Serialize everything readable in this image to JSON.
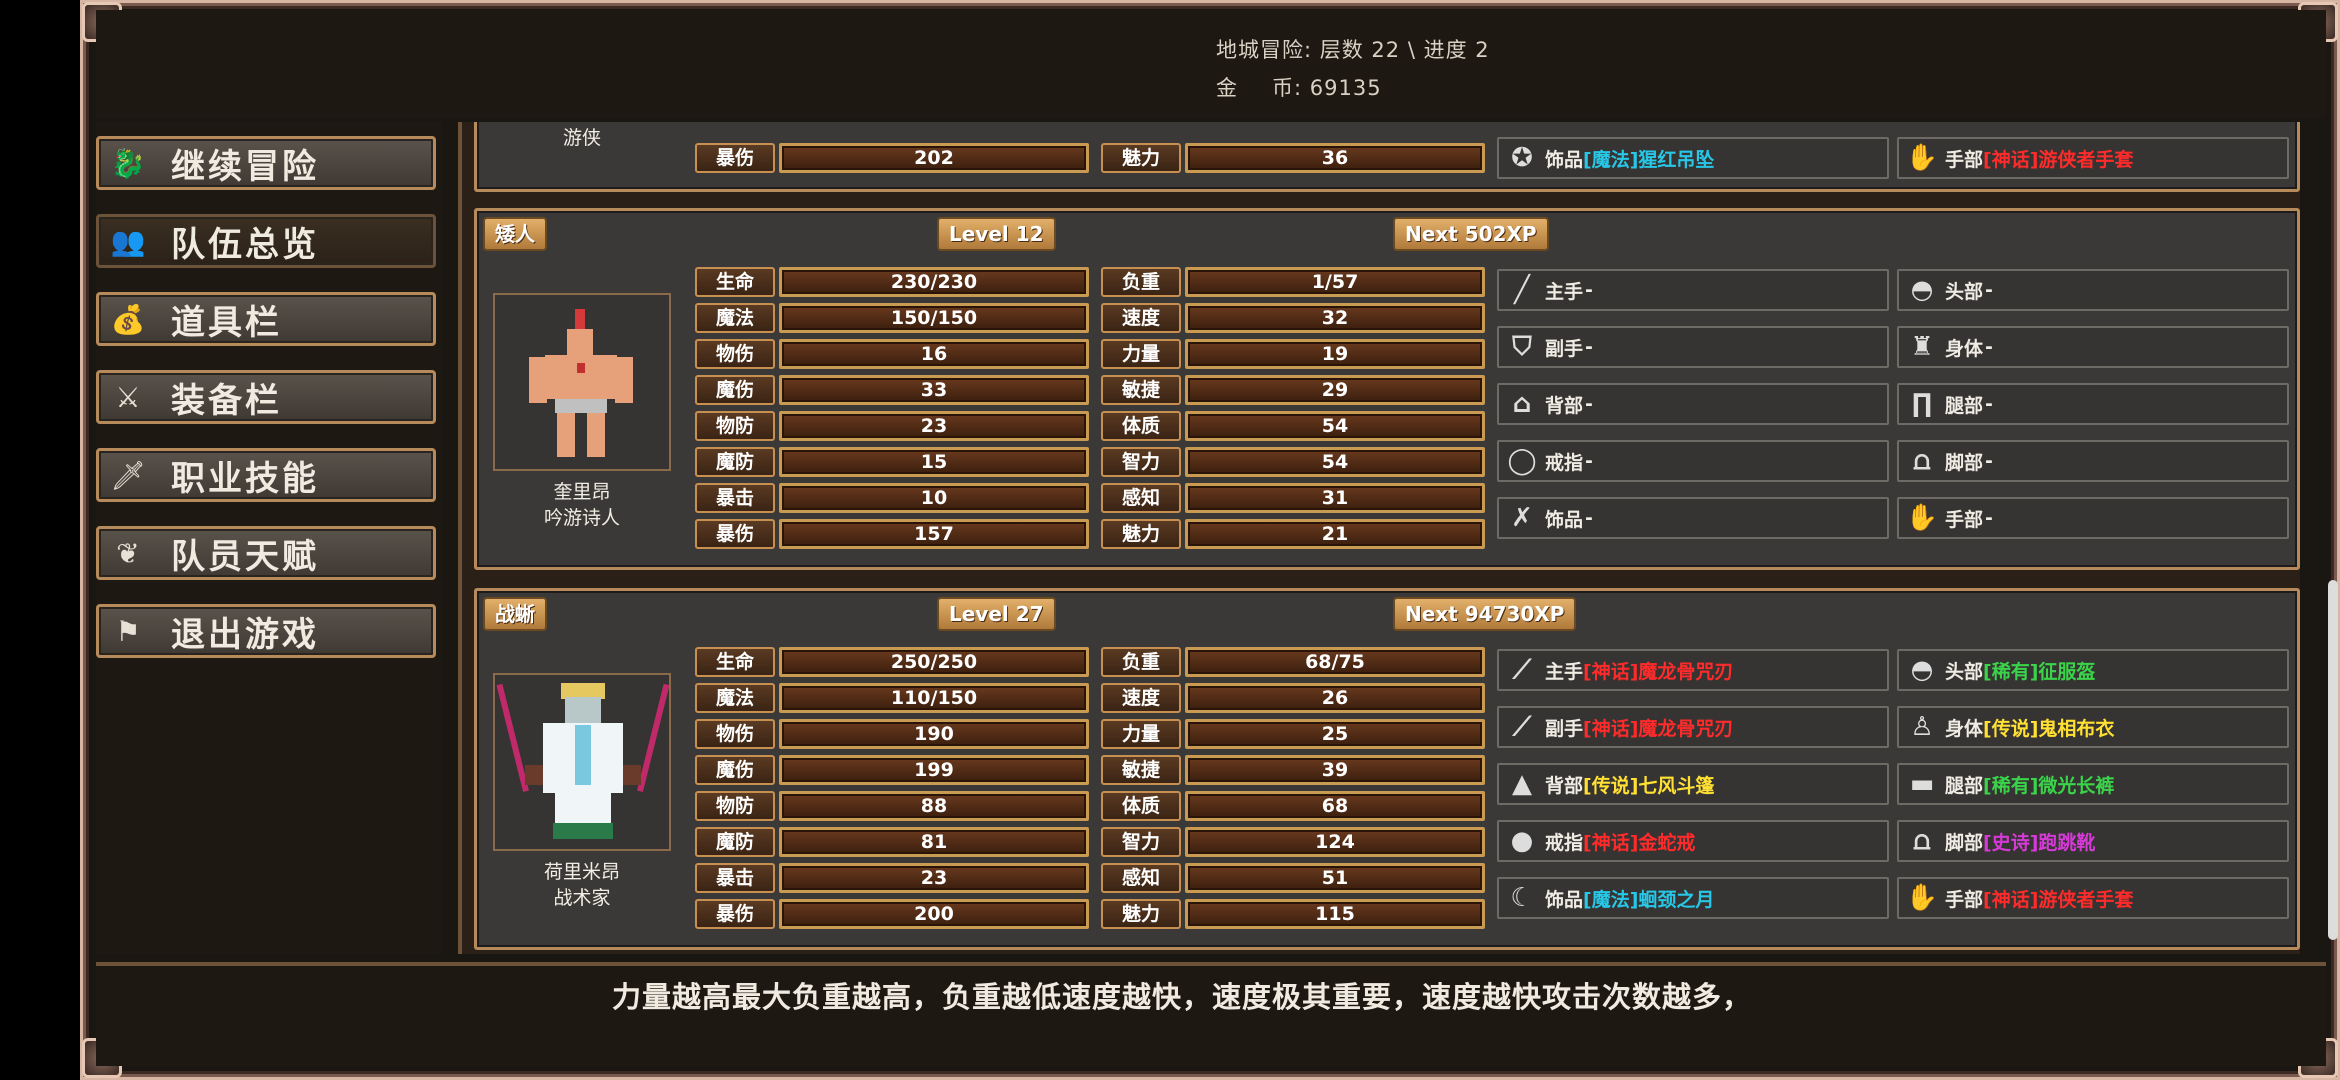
{
  "header": {
    "line1": "地城冒险: 层数 22 \\ 进度 2",
    "gold_label_a": "金",
    "gold_label_b": "币: 69135"
  },
  "sidebar": {
    "items": [
      {
        "label": "继续冒险",
        "icon": "dragon-icon",
        "active": false
      },
      {
        "label": "队伍总览",
        "icon": "party-icon",
        "active": true
      },
      {
        "label": "道具栏",
        "icon": "bag-icon",
        "active": false
      },
      {
        "label": "装备栏",
        "icon": "weapons-icon",
        "active": false
      },
      {
        "label": "职业技能",
        "icon": "sword-wings-icon",
        "active": false
      },
      {
        "label": "队员天赋",
        "icon": "laurel-icon",
        "active": false
      },
      {
        "label": "退出游戏",
        "icon": "flag-icon",
        "active": false
      }
    ]
  },
  "top_partial": {
    "class_label": "游侠",
    "stat_left_label": "暴伤",
    "stat_left_value": "202",
    "stat_right_label": "魅力",
    "stat_right_value": "36",
    "eq_left": {
      "slot": "饰品",
      "quality": "[魔法]",
      "name": "猩红吊坠",
      "q": "mofa"
    },
    "eq_right": {
      "slot": "手部",
      "quality": "[神话]",
      "name": "游侠者手套",
      "q": "shenhua"
    }
  },
  "characters": [
    {
      "race": "矮人",
      "level": "Level 12",
      "next": "Next 502XP",
      "name": "奎里昂",
      "class": "吟游诗人",
      "stats_left": [
        {
          "label": "生命",
          "value": "230/230"
        },
        {
          "label": "魔法",
          "value": "150/150"
        },
        {
          "label": "物伤",
          "value": "16"
        },
        {
          "label": "魔伤",
          "value": "33"
        },
        {
          "label": "物防",
          "value": "23"
        },
        {
          "label": "魔防",
          "value": "15"
        },
        {
          "label": "暴击",
          "value": "10"
        },
        {
          "label": "暴伤",
          "value": "157"
        }
      ],
      "stats_right": [
        {
          "label": "负重",
          "value": "1/57"
        },
        {
          "label": "速度",
          "value": "32"
        },
        {
          "label": "力量",
          "value": "19"
        },
        {
          "label": "敏捷",
          "value": "29"
        },
        {
          "label": "体质",
          "value": "54"
        },
        {
          "label": "智力",
          "value": "54"
        },
        {
          "label": "感知",
          "value": "31"
        },
        {
          "label": "魅力",
          "value": "21"
        }
      ],
      "equip_left": [
        {
          "slot": "主手",
          "dash": "-",
          "icon": "sword-icon"
        },
        {
          "slot": "副手",
          "dash": "-",
          "icon": "shield-icon"
        },
        {
          "slot": "背部",
          "dash": "-",
          "icon": "cape-icon"
        },
        {
          "slot": "戒指",
          "dash": "-",
          "icon": "ring-icon"
        },
        {
          "slot": "饰品",
          "dash": "-",
          "icon": "amulet-icon"
        }
      ],
      "equip_right": [
        {
          "slot": "头部",
          "dash": "-",
          "icon": "helmet-icon"
        },
        {
          "slot": "身体",
          "dash": "-",
          "icon": "armor-icon"
        },
        {
          "slot": "腿部",
          "dash": "-",
          "icon": "legs-icon"
        },
        {
          "slot": "脚部",
          "dash": "-",
          "icon": "boots-icon"
        },
        {
          "slot": "手部",
          "dash": "-",
          "icon": "gloves-icon"
        }
      ]
    },
    {
      "race": "战蜥",
      "level": "Level 27",
      "next": "Next 94730XP",
      "name": "荷里米昂",
      "class": "战术家",
      "stats_left": [
        {
          "label": "生命",
          "value": "250/250"
        },
        {
          "label": "魔法",
          "value": "110/150"
        },
        {
          "label": "物伤",
          "value": "190"
        },
        {
          "label": "魔伤",
          "value": "199"
        },
        {
          "label": "物防",
          "value": "88"
        },
        {
          "label": "魔防",
          "value": "81"
        },
        {
          "label": "暴击",
          "value": "23"
        },
        {
          "label": "暴伤",
          "value": "200"
        }
      ],
      "stats_right": [
        {
          "label": "负重",
          "value": "68/75"
        },
        {
          "label": "速度",
          "value": "26"
        },
        {
          "label": "力量",
          "value": "25"
        },
        {
          "label": "敏捷",
          "value": "39"
        },
        {
          "label": "体质",
          "value": "68"
        },
        {
          "label": "智力",
          "value": "124"
        },
        {
          "label": "感知",
          "value": "51"
        },
        {
          "label": "魅力",
          "value": "115"
        }
      ],
      "equip_left": [
        {
          "slot": "主手",
          "quality": "[神话]",
          "name": "魔龙骨咒刃",
          "q": "shenhua",
          "icon": "purple-blade-icon"
        },
        {
          "slot": "副手",
          "quality": "[神话]",
          "name": "魔龙骨咒刃",
          "q": "shenhua",
          "icon": "purple-blade-icon"
        },
        {
          "slot": "背部",
          "quality": "[传说]",
          "name": "七风斗篷",
          "q": "chuanshuo",
          "icon": "cloak-icon"
        },
        {
          "slot": "戒指",
          "quality": "[神话]",
          "name": "金蛇戒",
          "q": "shenhua",
          "icon": "gold-ring-icon"
        },
        {
          "slot": "饰品",
          "quality": "[魔法]",
          "name": "蛔颈之月",
          "q": "mofa",
          "icon": "moon-amulet-icon"
        }
      ],
      "equip_right": [
        {
          "slot": "头部",
          "quality": "[稀有]",
          "name": "征服盔",
          "q": "xiyou",
          "icon": "bronze-helmet-icon"
        },
        {
          "slot": "身体",
          "quality": "[传说]",
          "name": "鬼相布衣",
          "q": "chuanshuo",
          "icon": "robe-icon"
        },
        {
          "slot": "腿部",
          "quality": "[稀有]",
          "name": "微光长裤",
          "q": "xiyou",
          "icon": "pants-icon"
        },
        {
          "slot": "脚部",
          "quality": "[史诗]",
          "name": "跑跳靴",
          "q": "shishi",
          "icon": "green-boots-icon"
        },
        {
          "slot": "手部",
          "quality": "[神话]",
          "name": "游侠者手套",
          "q": "shenhua",
          "icon": "gauntlet-icon"
        }
      ]
    }
  ],
  "footer": {
    "tip": "力量越高最大负重越高，负重越低速度越快，速度极其重要，速度越快攻击次数越多，"
  },
  "colors": {
    "mofa": "#27c7e8",
    "shenhua": "#ff2b2b",
    "chuanshuo": "#ffe033",
    "xiyou": "#3bd34a",
    "shishi": "#d63ad6",
    "gold_border": "#c89a52"
  }
}
